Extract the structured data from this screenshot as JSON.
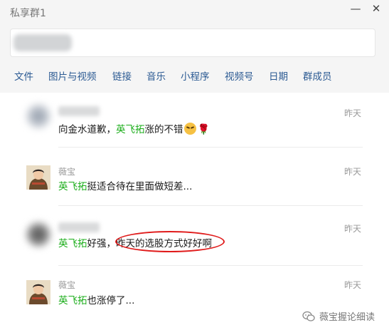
{
  "window": {
    "title": "私享群1"
  },
  "window_controls": {
    "minimize": "—",
    "close": "✕"
  },
  "search": {
    "value": "",
    "placeholder": ""
  },
  "tabs": [
    "文件",
    "图片与视频",
    "链接",
    "音乐",
    "小程序",
    "视频号",
    "日期",
    "群成员"
  ],
  "messages": [
    {
      "sender": "",
      "time": "昨天",
      "before": "向金水道歉，",
      "mention": "英飞拓",
      "after": "涨的不错",
      "emoji_face": "grimacing-face",
      "emoji_rose": "🌹"
    },
    {
      "sender": "薇宝",
      "time": "昨天",
      "mention": "英飞拓",
      "after": "挺适合待在里面做短差..."
    },
    {
      "sender": "",
      "time": "昨天",
      "mention": "英飞拓",
      "after": "好强，",
      "highlighted": "昨天的选股方式好好啊"
    },
    {
      "sender": "薇宝",
      "time": "昨天",
      "mention": "英飞拓",
      "after": "也涨停了..."
    }
  ],
  "annotation": {
    "color": "#e01b1b"
  },
  "watermark": {
    "text": "薇宝握论细读",
    "icon": "wechat-official-account-icon"
  },
  "colors": {
    "mention": "#1aad19",
    "tab_text": "#2b5a93",
    "header_bg": "#f5f5f5"
  }
}
